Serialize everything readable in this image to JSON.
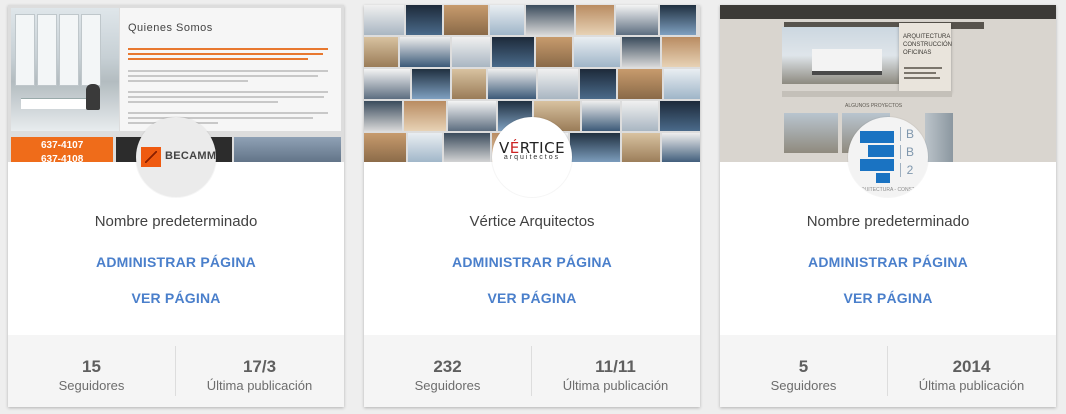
{
  "pages": [
    {
      "name": "Nombre predeterminado",
      "admin_label": "ADMINISTRAR PÁGINA",
      "view_label": "VER PÁGINA",
      "followers": "15",
      "followers_label": "Seguidores",
      "last_post": "17/3",
      "last_post_label": "Última publicación",
      "cover": {
        "heading": "Quienes Somos",
        "phone_1": "637-4107",
        "phone_2": "637-4108"
      },
      "logo_text": "BECAMM"
    },
    {
      "name": "Vértice Arquitectos",
      "admin_label": "ADMINISTRAR PÁGINA",
      "view_label": "VER PÁGINA",
      "followers": "232",
      "followers_label": "Seguidores",
      "last_post": "11/11",
      "last_post_label": "Última publicación",
      "logo_text_pre": "V",
      "logo_text_accent": "É",
      "logo_text_post": "RTICE",
      "logo_subtext": "arquitectos"
    },
    {
      "name": "Nombre predeterminado",
      "admin_label": "ADMINISTRAR PÁGINA",
      "view_label": "VER PÁGINA",
      "followers": "5",
      "followers_label": "Seguidores",
      "last_post": "2014",
      "last_post_label": "Última publicación",
      "cover": {
        "panel_line_1": "ARQUITECTURA",
        "panel_line_2": "CONSTRUCCIÓN",
        "panel_line_3": "OFICINAS",
        "section_title": "ALGUNOS PROYECTOS"
      },
      "logo_letters": [
        "B",
        "B",
        "2"
      ],
      "logo_caption": "ARQUITECTURA - CONSTRU"
    }
  ],
  "colors": {
    "link": "#4a7fcb",
    "name": "#424242",
    "stat_number": "#5f5f5f",
    "stat_label": "#6d6d6d",
    "stats_background": "#f5f5f5",
    "page_background": "#eeeeee",
    "becamm_orange": "#ef6c1a",
    "bb2_blue": "#1a73c2"
  }
}
